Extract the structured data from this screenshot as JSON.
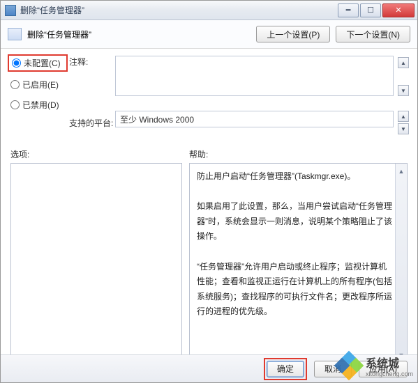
{
  "window": {
    "title": "删除“任务管理器”",
    "min_glyph": "━",
    "max_glyph": "☐",
    "close_glyph": "✕"
  },
  "header": {
    "label": "删除“任务管理器”",
    "prev_btn": "上一个设置(P)",
    "next_btn": "下一个设置(N)"
  },
  "config": {
    "comment_label": "注释:",
    "not_configured": "未配置(C)",
    "enabled": "已启用(E)",
    "disabled": "已禁用(D)",
    "platform_label": "支持的平台:",
    "platform_value": "至少 Windows 2000",
    "comment_value": "",
    "up": "▲",
    "down": "▼"
  },
  "mid": {
    "options": "选项:",
    "help": "帮助:"
  },
  "help": {
    "p1": "防止用户启动“任务管理器”(Taskmgr.exe)。",
    "p2": "如果启用了此设置，那么，当用户尝试启动“任务管理器”时，系统会显示一则消息，说明某个策略阻止了该操作。",
    "p3": "“任务管理器”允许用户启动或终止程序；监视计算机性能；查看和监视正运行在计算机上的所有程序(包括系统服务)；查找程序的可执行文件名；更改程序所运行的进程的优先级。"
  },
  "footer": {
    "ok": "确定",
    "cancel": "取消",
    "apply": "应用(A)"
  },
  "watermark": {
    "brand": "系统城",
    "url": "xitongcheng.com"
  }
}
